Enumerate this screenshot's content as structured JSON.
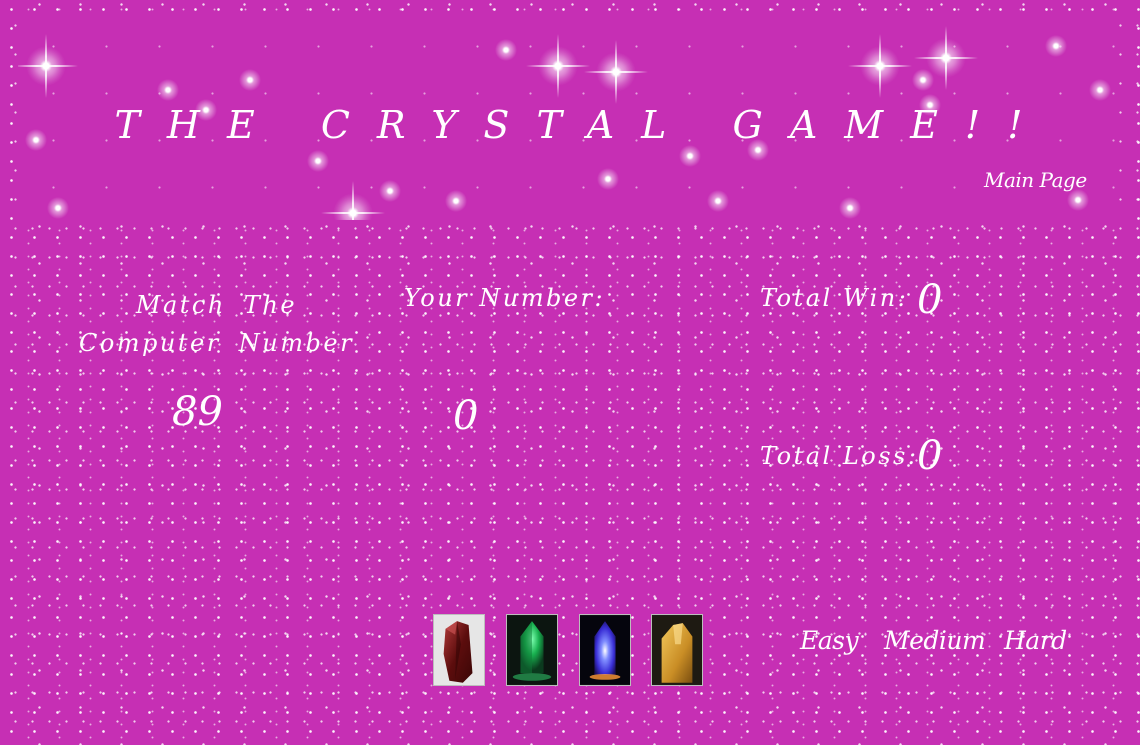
{
  "header": {
    "title": "THE CRYSTAL GAME!!",
    "main_page_link": "Main Page"
  },
  "game": {
    "computer_label": "Match The Computer Number",
    "computer_number": "89",
    "your_label": "Your Number:",
    "your_number": "0",
    "win_label": "Total Win:",
    "win_value": "0",
    "loss_label": "Total Loss:",
    "loss_value": "0"
  },
  "crystals": [
    {
      "name": "red-crystal",
      "color": "#8b1e1e"
    },
    {
      "name": "green-crystal",
      "color": "#19c35a"
    },
    {
      "name": "blue-crystal",
      "color": "#3a4dff"
    },
    {
      "name": "yellow-crystal",
      "color": "#d9a43a"
    }
  ],
  "difficulty": {
    "easy": "Easy",
    "medium": "Medium",
    "hard": "Hard"
  },
  "colors": {
    "background": "#c62fb4",
    "text": "#ffffff"
  }
}
